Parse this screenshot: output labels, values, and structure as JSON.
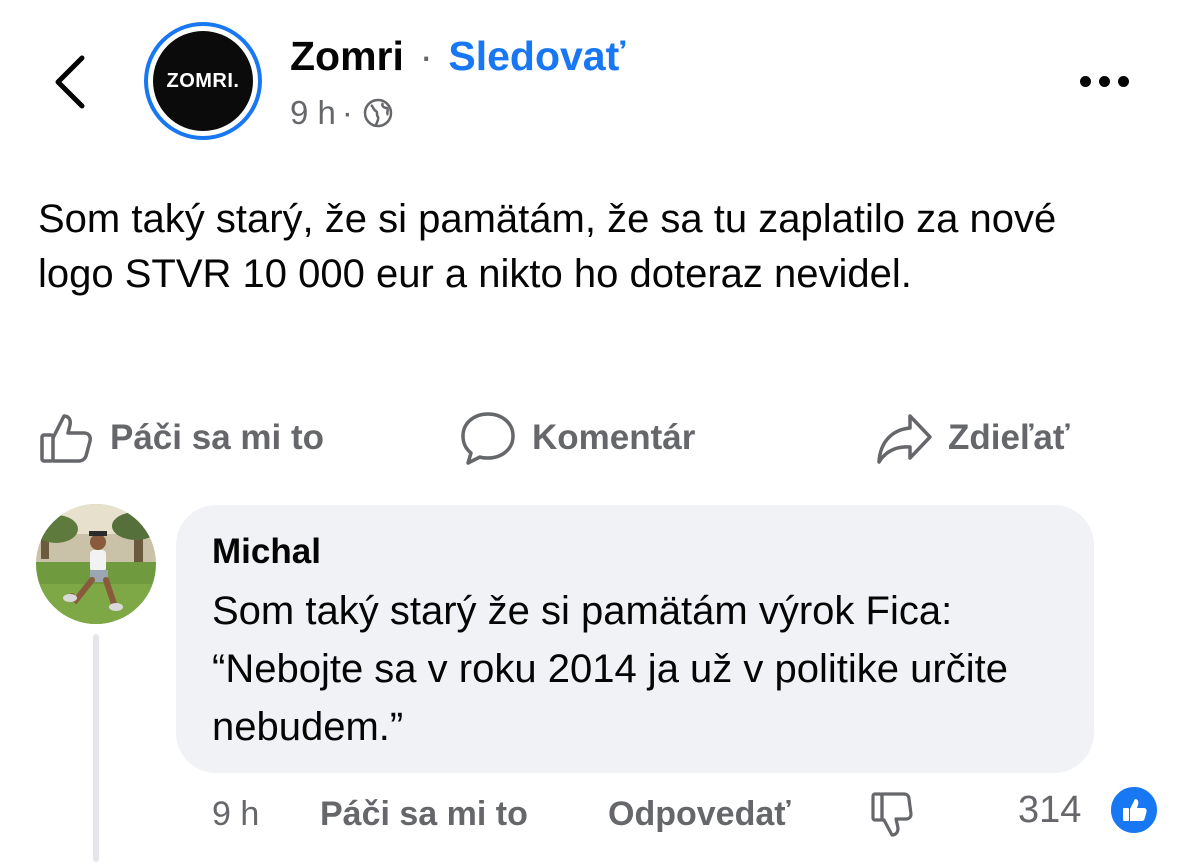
{
  "header": {
    "page_name": "Zomri",
    "separator": "·",
    "follow_label": "Sledovať",
    "time": "9 h",
    "meta_separator": "·",
    "avatar_text": "ZOMRI.",
    "privacy_icon": "globe-icon"
  },
  "post": {
    "text": "Som taký starý, že si pamätám, že sa tu zaplatilo za nové logo STVR 10 000 eur a nikto ho doteraz nevidel."
  },
  "actions": {
    "like_label": "Páči sa mi to",
    "comment_label": "Komentár",
    "share_label": "Zdieľať"
  },
  "comment": {
    "author": "Michal",
    "text": "Som taký starý že si pamätám výrok Fica: “Nebojte sa v roku 2014 ja už v politike určite nebudem.”",
    "time": "9 h",
    "like_label": "Páči sa mi to",
    "reply_label": "Odpovedať",
    "reaction_count": "314"
  },
  "colors": {
    "accent": "#1877f2",
    "secondary_text": "#65676b",
    "bubble": "#f0f2f5"
  }
}
